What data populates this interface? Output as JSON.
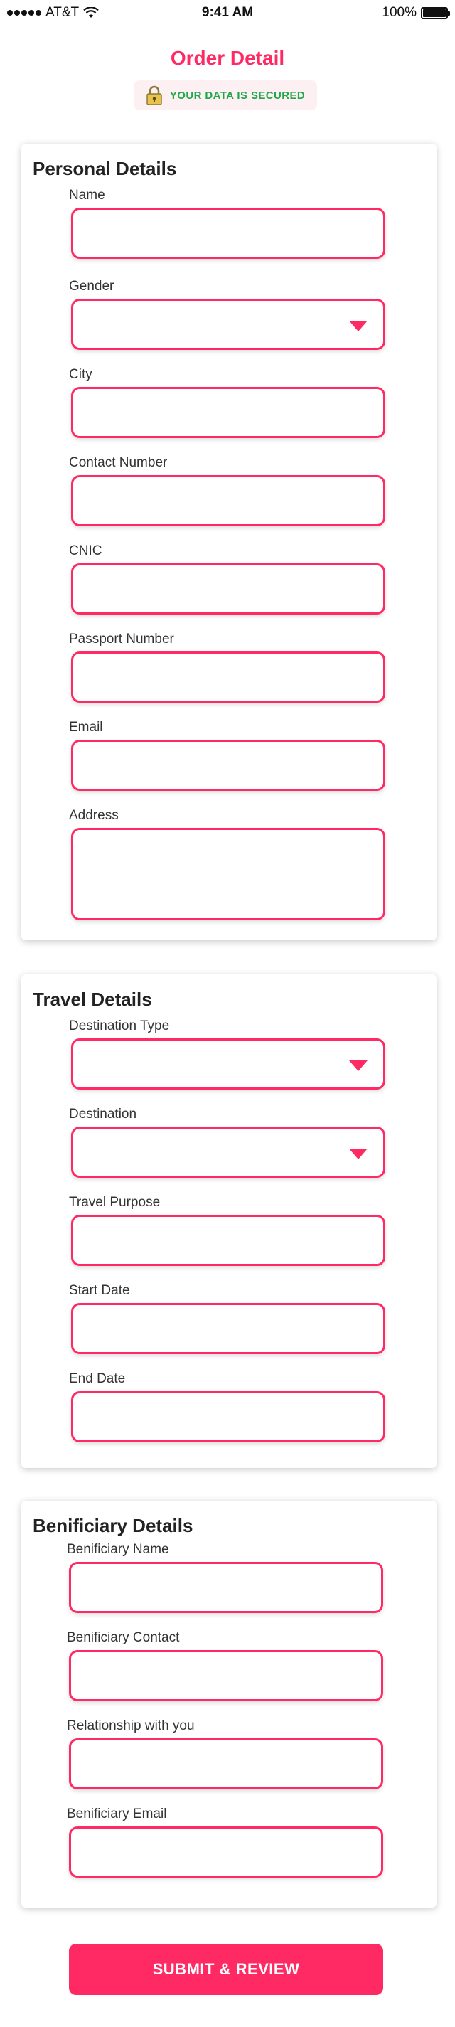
{
  "status_bar": {
    "carrier": "AT&T",
    "time": "9:41 AM",
    "battery": "100%",
    "battery_level": 1.0
  },
  "header": {
    "title": "Order Detail",
    "secure_text": "YOUR DATA IS SECURED"
  },
  "colors": {
    "accent": "#ff2a63",
    "secure_green": "#1ea84a",
    "badge_bg": "#fdf0f3"
  },
  "personal": {
    "title": "Personal Details",
    "name_label": "Name",
    "gender_label": "Gender",
    "city_label": "City",
    "contact_label": "Contact Number",
    "cnic_label": "CNIC",
    "passport_label": "Passport Number",
    "email_label": "Email",
    "address_label": "Address"
  },
  "travel": {
    "title": "Travel Details",
    "destination_type_label": "Destination Type",
    "destination_label": "Destination",
    "purpose_label": "Travel Purpose",
    "start_date_label": "Start Date",
    "end_date_label": "End Date"
  },
  "beneficiary": {
    "title": "Benificiary Details",
    "name_label": "Benificiary Name",
    "contact_label": "Benificiary Contact",
    "relationship_label": "Relationship with you",
    "email_label": "Benificiary Email"
  },
  "actions": {
    "submit_label": "SUBMIT & REVIEW"
  },
  "icons": {
    "signal": "signal-dots-icon",
    "wifi": "wifi-icon",
    "battery": "battery-icon",
    "lock": "lock-icon",
    "dropdown": "caret-down-icon"
  }
}
